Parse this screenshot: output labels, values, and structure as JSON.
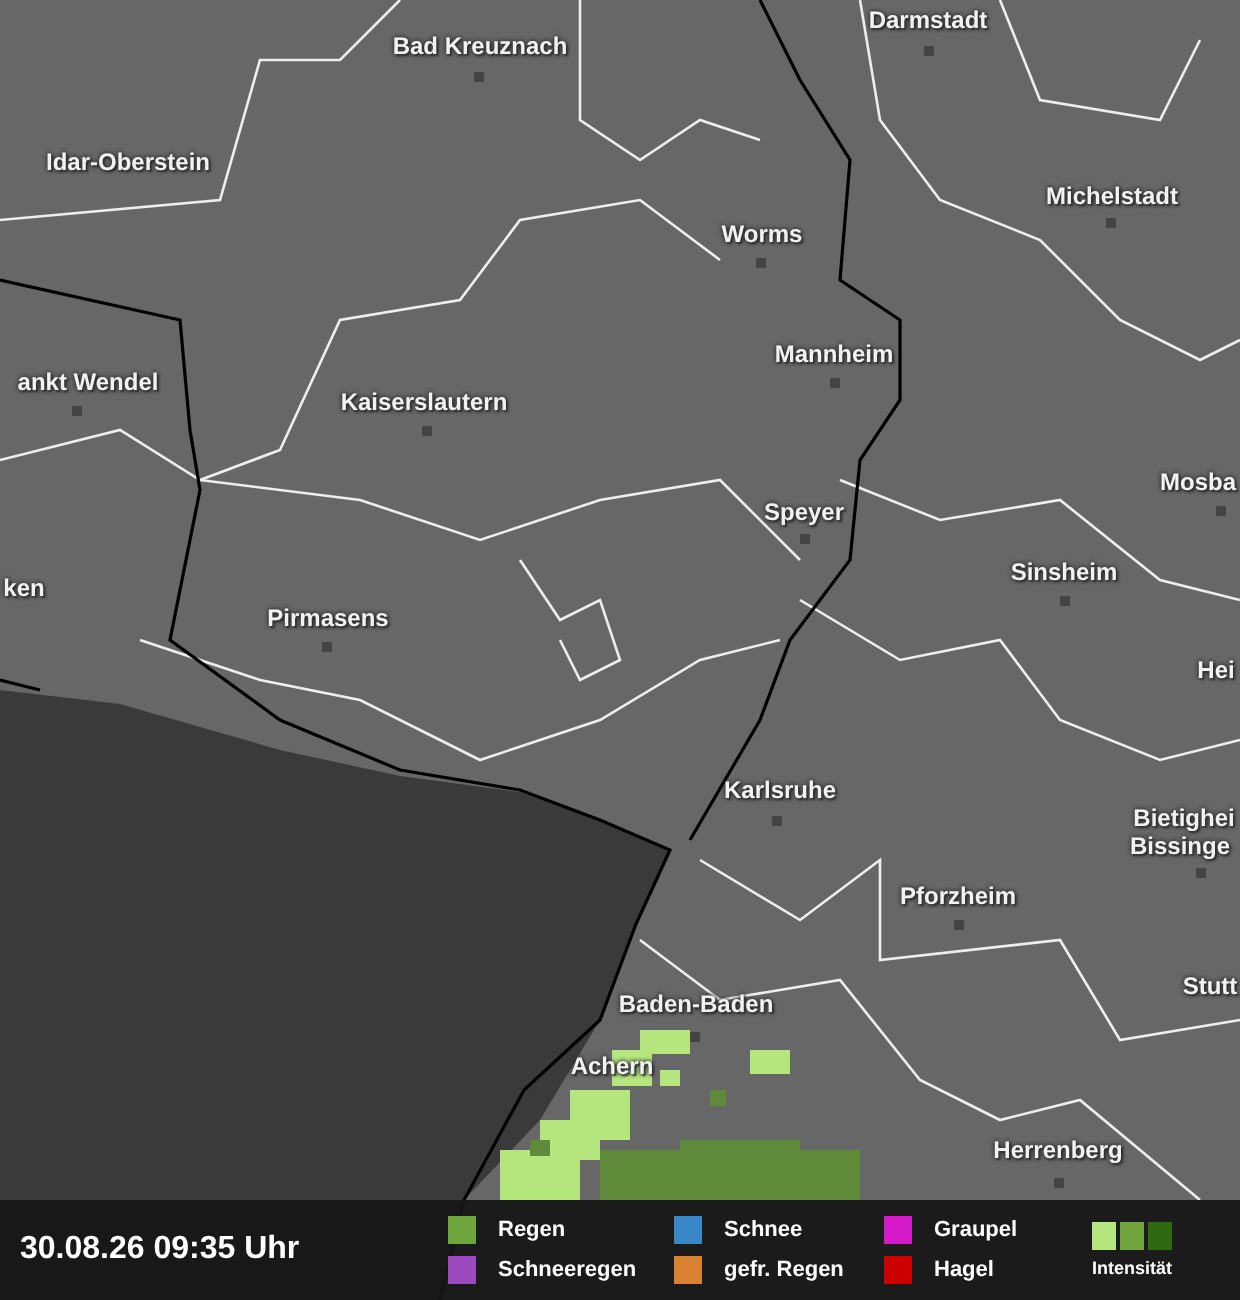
{
  "map": {
    "cities": [
      {
        "name": "Bad Kreuznach",
        "dot": true
      },
      {
        "name": "Darmstadt",
        "dot": true
      },
      {
        "name": "Idar-Oberstein",
        "dot": false
      },
      {
        "name": "Michelstadt",
        "dot": true
      },
      {
        "name": "Worms",
        "dot": true
      },
      {
        "name": "Mannheim",
        "dot": true
      },
      {
        "name": "ankt Wendel",
        "dot": true
      },
      {
        "name": "Kaiserslautern",
        "dot": true
      },
      {
        "name": "Mosba",
        "dot": true
      },
      {
        "name": "Speyer",
        "dot": true
      },
      {
        "name": "Sinsheim",
        "dot": true
      },
      {
        "name": "ken",
        "dot": false
      },
      {
        "name": "Pirmasens",
        "dot": true
      },
      {
        "name": "Hei",
        "dot": false
      },
      {
        "name": "Karlsruhe",
        "dot": true
      },
      {
        "name": "Bietighei",
        "dot": false
      },
      {
        "name": "Bissinge",
        "dot": true
      },
      {
        "name": "Pforzheim",
        "dot": true
      },
      {
        "name": "Stutt",
        "dot": false
      },
      {
        "name": "Baden-Baden",
        "dot": true
      },
      {
        "name": "Achern",
        "dot": false
      },
      {
        "name": "Herrenberg",
        "dot": true
      }
    ]
  },
  "footer": {
    "timestamp": "30.08.26 09:35 Uhr",
    "legend": [
      {
        "label": "Regen",
        "color": "#6fa53c"
      },
      {
        "label": "Schnee",
        "color": "#3a87c8"
      },
      {
        "label": "Graupel",
        "color": "#d41ac8"
      },
      {
        "label": "Schneeregen",
        "color": "#9b4bbf"
      },
      {
        "label": "gefr. Regen",
        "color": "#d98234"
      },
      {
        "label": "Hagel",
        "color": "#cc0000"
      }
    ],
    "intensity_label": "Intensität"
  }
}
